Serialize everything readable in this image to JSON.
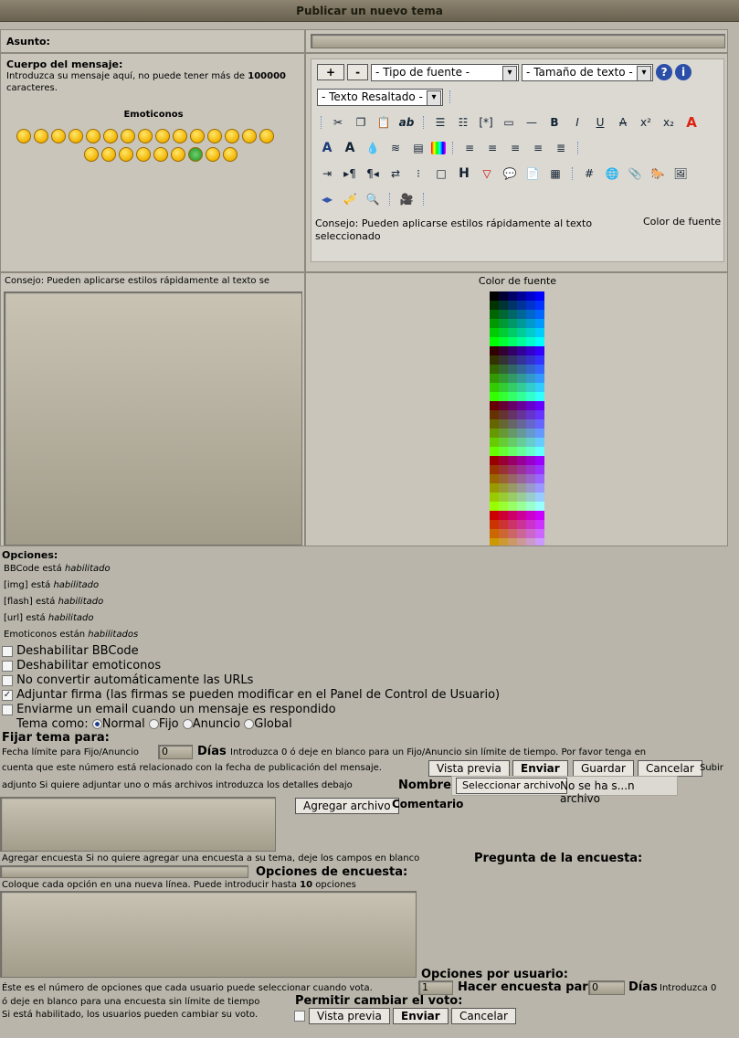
{
  "header": {
    "title": "Publicar un nuevo tema"
  },
  "subject": {
    "label": "Asunto:",
    "value": ""
  },
  "body": {
    "label": "Cuerpo del mensaje:",
    "hint_prefix": "Introduzca su mensaje aquí, no puede tener más de",
    "hint_limit": "100000",
    "hint_suffix": "caracteres.",
    "emoticons_title": "Emoticonos"
  },
  "editor": {
    "font_type": "- Tipo de fuente -",
    "font_size": "- Tamaño de texto -",
    "highlight": "- Texto Resaltado -",
    "plus": "+",
    "minus": "-",
    "tip": "Consejo: Pueden aplicarse estilos rápidamente al texto seleccionado",
    "font_color": "Color de fuente",
    "row_tip": "Consejo: Pueden aplicarse estilos rápidamente al texto se",
    "row_color": "Color de fuente"
  },
  "options": {
    "title": "Opciones:",
    "bbcode": {
      "pre": "BBCode está",
      "state": "habilitado"
    },
    "img": {
      "pre": "[img] está",
      "state": "habilitado"
    },
    "flash": {
      "pre": "[flash] está",
      "state": "habilitado"
    },
    "url": {
      "pre": "[url] está",
      "state": "habilitado"
    },
    "smilies": {
      "pre": "Emoticonos están",
      "state": "habilitados"
    },
    "disable_bbcode": "Deshabilitar BBCode",
    "disable_smilies": "Deshabilitar emoticonos",
    "no_urls": "No convertir automáticamente las URLs",
    "attach_sig": "Adjuntar firma (las firmas se pueden modificar en el Panel de Control de Usuario)",
    "notify": "Enviarme un email cuando un mensaje es respondido",
    "topic_as": "Tema como:",
    "types": [
      "Normal",
      "Fijo",
      "Anuncio",
      "Global"
    ]
  },
  "sticky": {
    "title": "Fijar tema para:",
    "limit_label": "Fecha límite para Fijo/Anuncio",
    "days_value": "0",
    "days": "Días",
    "hint1": "Introduzca 0 ó deje en blanco para un Fijo/Anuncio sin límite de tiempo. Por favor tenga en",
    "hint2": "cuenta que este número está relacionado con la fecha de publicación del mensaje."
  },
  "buttons": {
    "preview": "Vista previa",
    "submit": "Enviar",
    "save": "Guardar",
    "cancel": "Cancelar"
  },
  "attach": {
    "upload": "Subir",
    "adjunto": "adjunto",
    "hint": "Si quiere adjuntar uno o más archivos introduzca los detalles debajo",
    "name_label": "Nombre",
    "browse": "Seleccionar archivo",
    "no_file": "No se ha s...n archivo",
    "add": "Agregar archivo",
    "comment": "Comentario"
  },
  "poll": {
    "add": "Agregar encuesta",
    "hint": "Si no quiere agregar una encuesta a su tema, deje los campos en blanco",
    "question": "Pregunta de la encuesta:",
    "options_label": "Opciones de encuesta:",
    "options_hint_pre": "Coloque cada opción en una nueva línea. Puede introducir hasta",
    "options_max": "10",
    "options_hint_post": "opciones",
    "per_user": "Opciones por usuario:",
    "per_user_hint": "Éste es el número de opciones que cada usuario puede seleccionar cuando vota.",
    "per_user_value": "1",
    "duration": "Hacer encuesta para:",
    "duration_value": "0",
    "days": "Días",
    "duration_hint1": "Introduzca 0",
    "duration_hint2": "ó deje en blanco para una encuesta sin límite de tiempo",
    "change_vote": "Permitir cambiar el voto:",
    "change_hint": "Si está habilitado, los usuarios pueden cambiar su voto."
  }
}
